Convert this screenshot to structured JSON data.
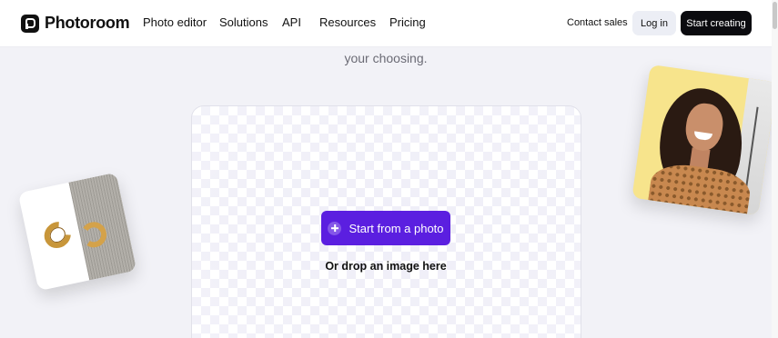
{
  "header": {
    "logo_text": "Photoroom",
    "nav": [
      "Photo editor",
      "Solutions",
      "API",
      "Resources",
      "Pricing"
    ],
    "contact_sales": "Contact sales",
    "log_in": "Log in",
    "start_creating": "Start creating"
  },
  "hero": {
    "subtitle": "your choosing."
  },
  "upload": {
    "button_label": "Start from a photo",
    "drop_text": "Or drop an image here",
    "button_color": "#5b1fe0"
  }
}
